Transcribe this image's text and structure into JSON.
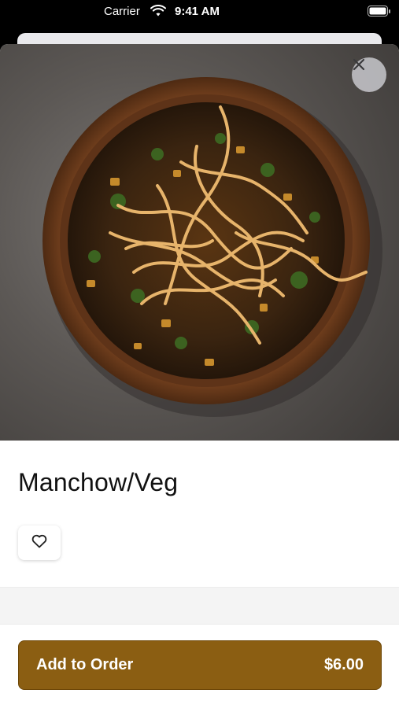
{
  "status_bar": {
    "carrier": "Carrier",
    "time": "9:41 AM",
    "wifi_icon": "wifi-icon",
    "battery_icon": "battery-icon"
  },
  "item": {
    "image_alt": "food-photo",
    "title": "Manchow/Veg",
    "favorite_icon": "heart-icon",
    "close_icon": "close-icon"
  },
  "order": {
    "button_label": "Add to Order",
    "price": "$6.00"
  },
  "colors": {
    "accent": "#8B5E12",
    "close_bg": "#C8C8CC"
  }
}
